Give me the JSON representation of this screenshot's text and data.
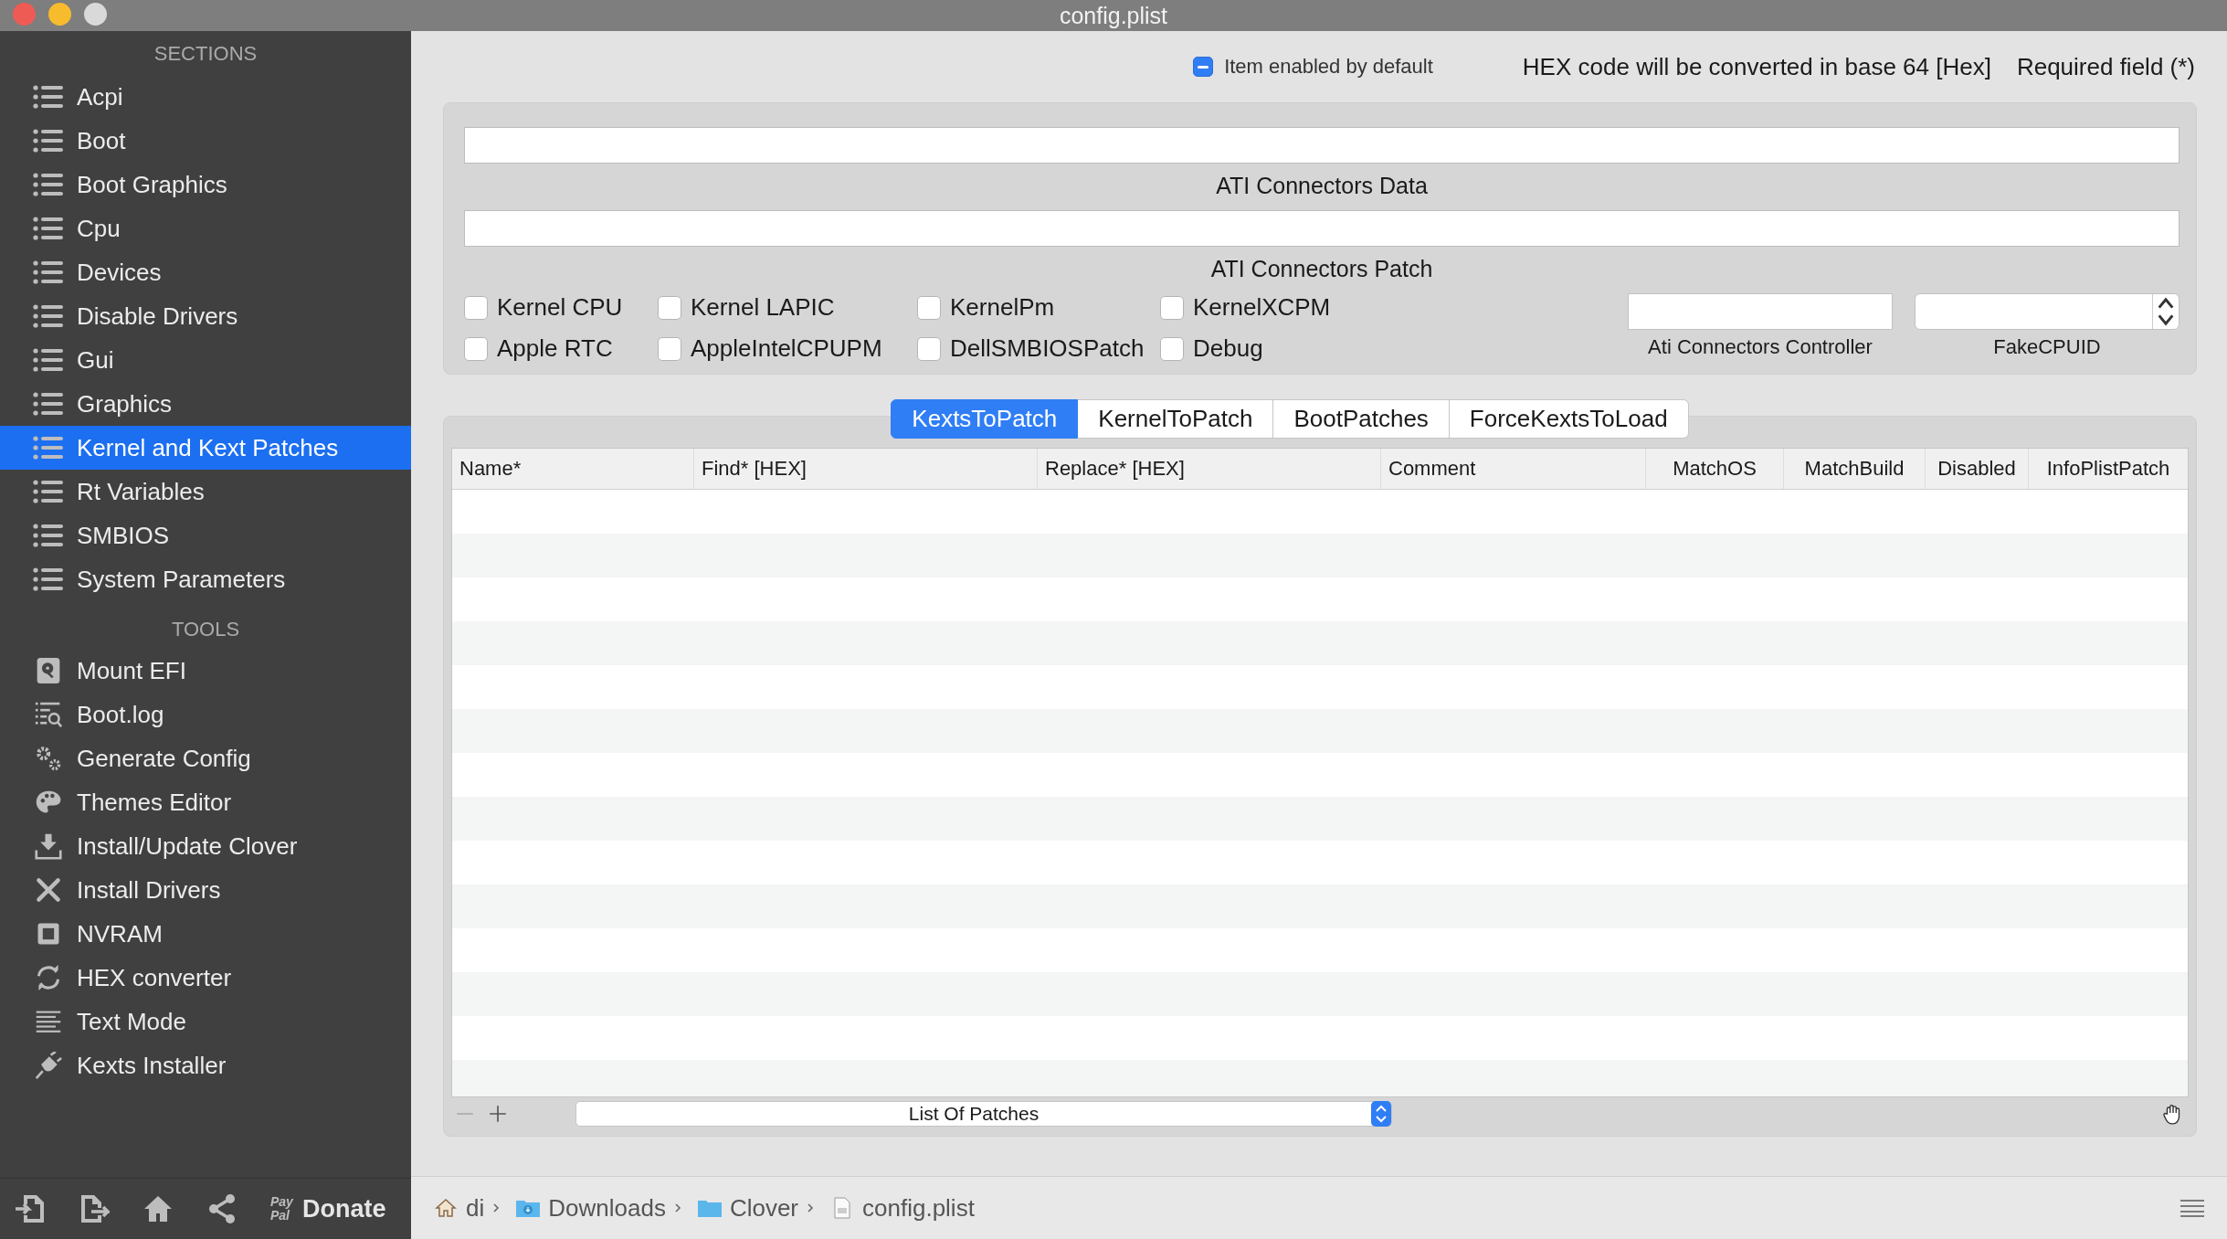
{
  "window": {
    "title": "config.plist"
  },
  "sidebar": {
    "sections_heading": "SECTIONS",
    "sections": [
      {
        "label": "Acpi",
        "selected": false
      },
      {
        "label": "Boot",
        "selected": false
      },
      {
        "label": "Boot Graphics",
        "selected": false
      },
      {
        "label": "Cpu",
        "selected": false
      },
      {
        "label": "Devices",
        "selected": false
      },
      {
        "label": "Disable Drivers",
        "selected": false
      },
      {
        "label": "Gui",
        "selected": false
      },
      {
        "label": "Graphics",
        "selected": false
      },
      {
        "label": "Kernel and Kext Patches",
        "selected": true
      },
      {
        "label": "Rt Variables",
        "selected": false
      },
      {
        "label": "SMBIOS",
        "selected": false
      },
      {
        "label": "System Parameters",
        "selected": false
      }
    ],
    "tools_heading": "TOOLS",
    "tools": [
      {
        "label": "Mount EFI"
      },
      {
        "label": "Boot.log"
      },
      {
        "label": "Generate Config"
      },
      {
        "label": "Themes Editor"
      },
      {
        "label": "Install/Update Clover"
      },
      {
        "label": "Install Drivers"
      },
      {
        "label": "NVRAM"
      },
      {
        "label": "HEX converter"
      },
      {
        "label": "Text Mode"
      },
      {
        "label": "Kexts Installer"
      }
    ],
    "donate": {
      "paypal_top": "Pay",
      "paypal_bottom": "Pal",
      "label": "Donate"
    }
  },
  "legend": {
    "enabled_default": {
      "label": "Item enabled by default",
      "indeterminate": true
    },
    "hex_note": "HEX code will be converted in base 64 [Hex]",
    "required_note": "Required field (*)"
  },
  "ati": {
    "data_label": "ATI Connectors Data",
    "patch_label": "ATI Connectors Patch"
  },
  "options": [
    {
      "label": "Kernel CPU",
      "checked": false
    },
    {
      "label": "Kernel LAPIC",
      "checked": false
    },
    {
      "label": "KernelPm",
      "checked": false
    },
    {
      "label": "KernelXCPM",
      "checked": false
    },
    {
      "label": "Apple RTC",
      "checked": false
    },
    {
      "label": "AppleIntelCPUPM",
      "checked": false
    },
    {
      "label": "DellSMBIOSPatch",
      "checked": false
    },
    {
      "label": "Debug",
      "checked": false
    }
  ],
  "side_fields": [
    {
      "label": "Ati Connectors Controller",
      "kind": "text"
    },
    {
      "label": "FakeCPUID",
      "kind": "stepper"
    }
  ],
  "tabs": [
    {
      "label": "KextsToPatch",
      "selected": true
    },
    {
      "label": "KernelToPatch",
      "selected": false
    },
    {
      "label": "BootPatches",
      "selected": false
    },
    {
      "label": "ForceKextsToLoad",
      "selected": false
    }
  ],
  "table": {
    "columns": [
      "Name*",
      "Find* [HEX]",
      "Replace* [HEX]",
      "Comment",
      "MatchOS",
      "MatchBuild",
      "Disabled",
      "InfoPlistPatch"
    ]
  },
  "list_selector": {
    "value": "List Of Patches"
  },
  "breadcrumb": [
    "di",
    "Downloads",
    "Clover",
    "config.plist"
  ]
}
